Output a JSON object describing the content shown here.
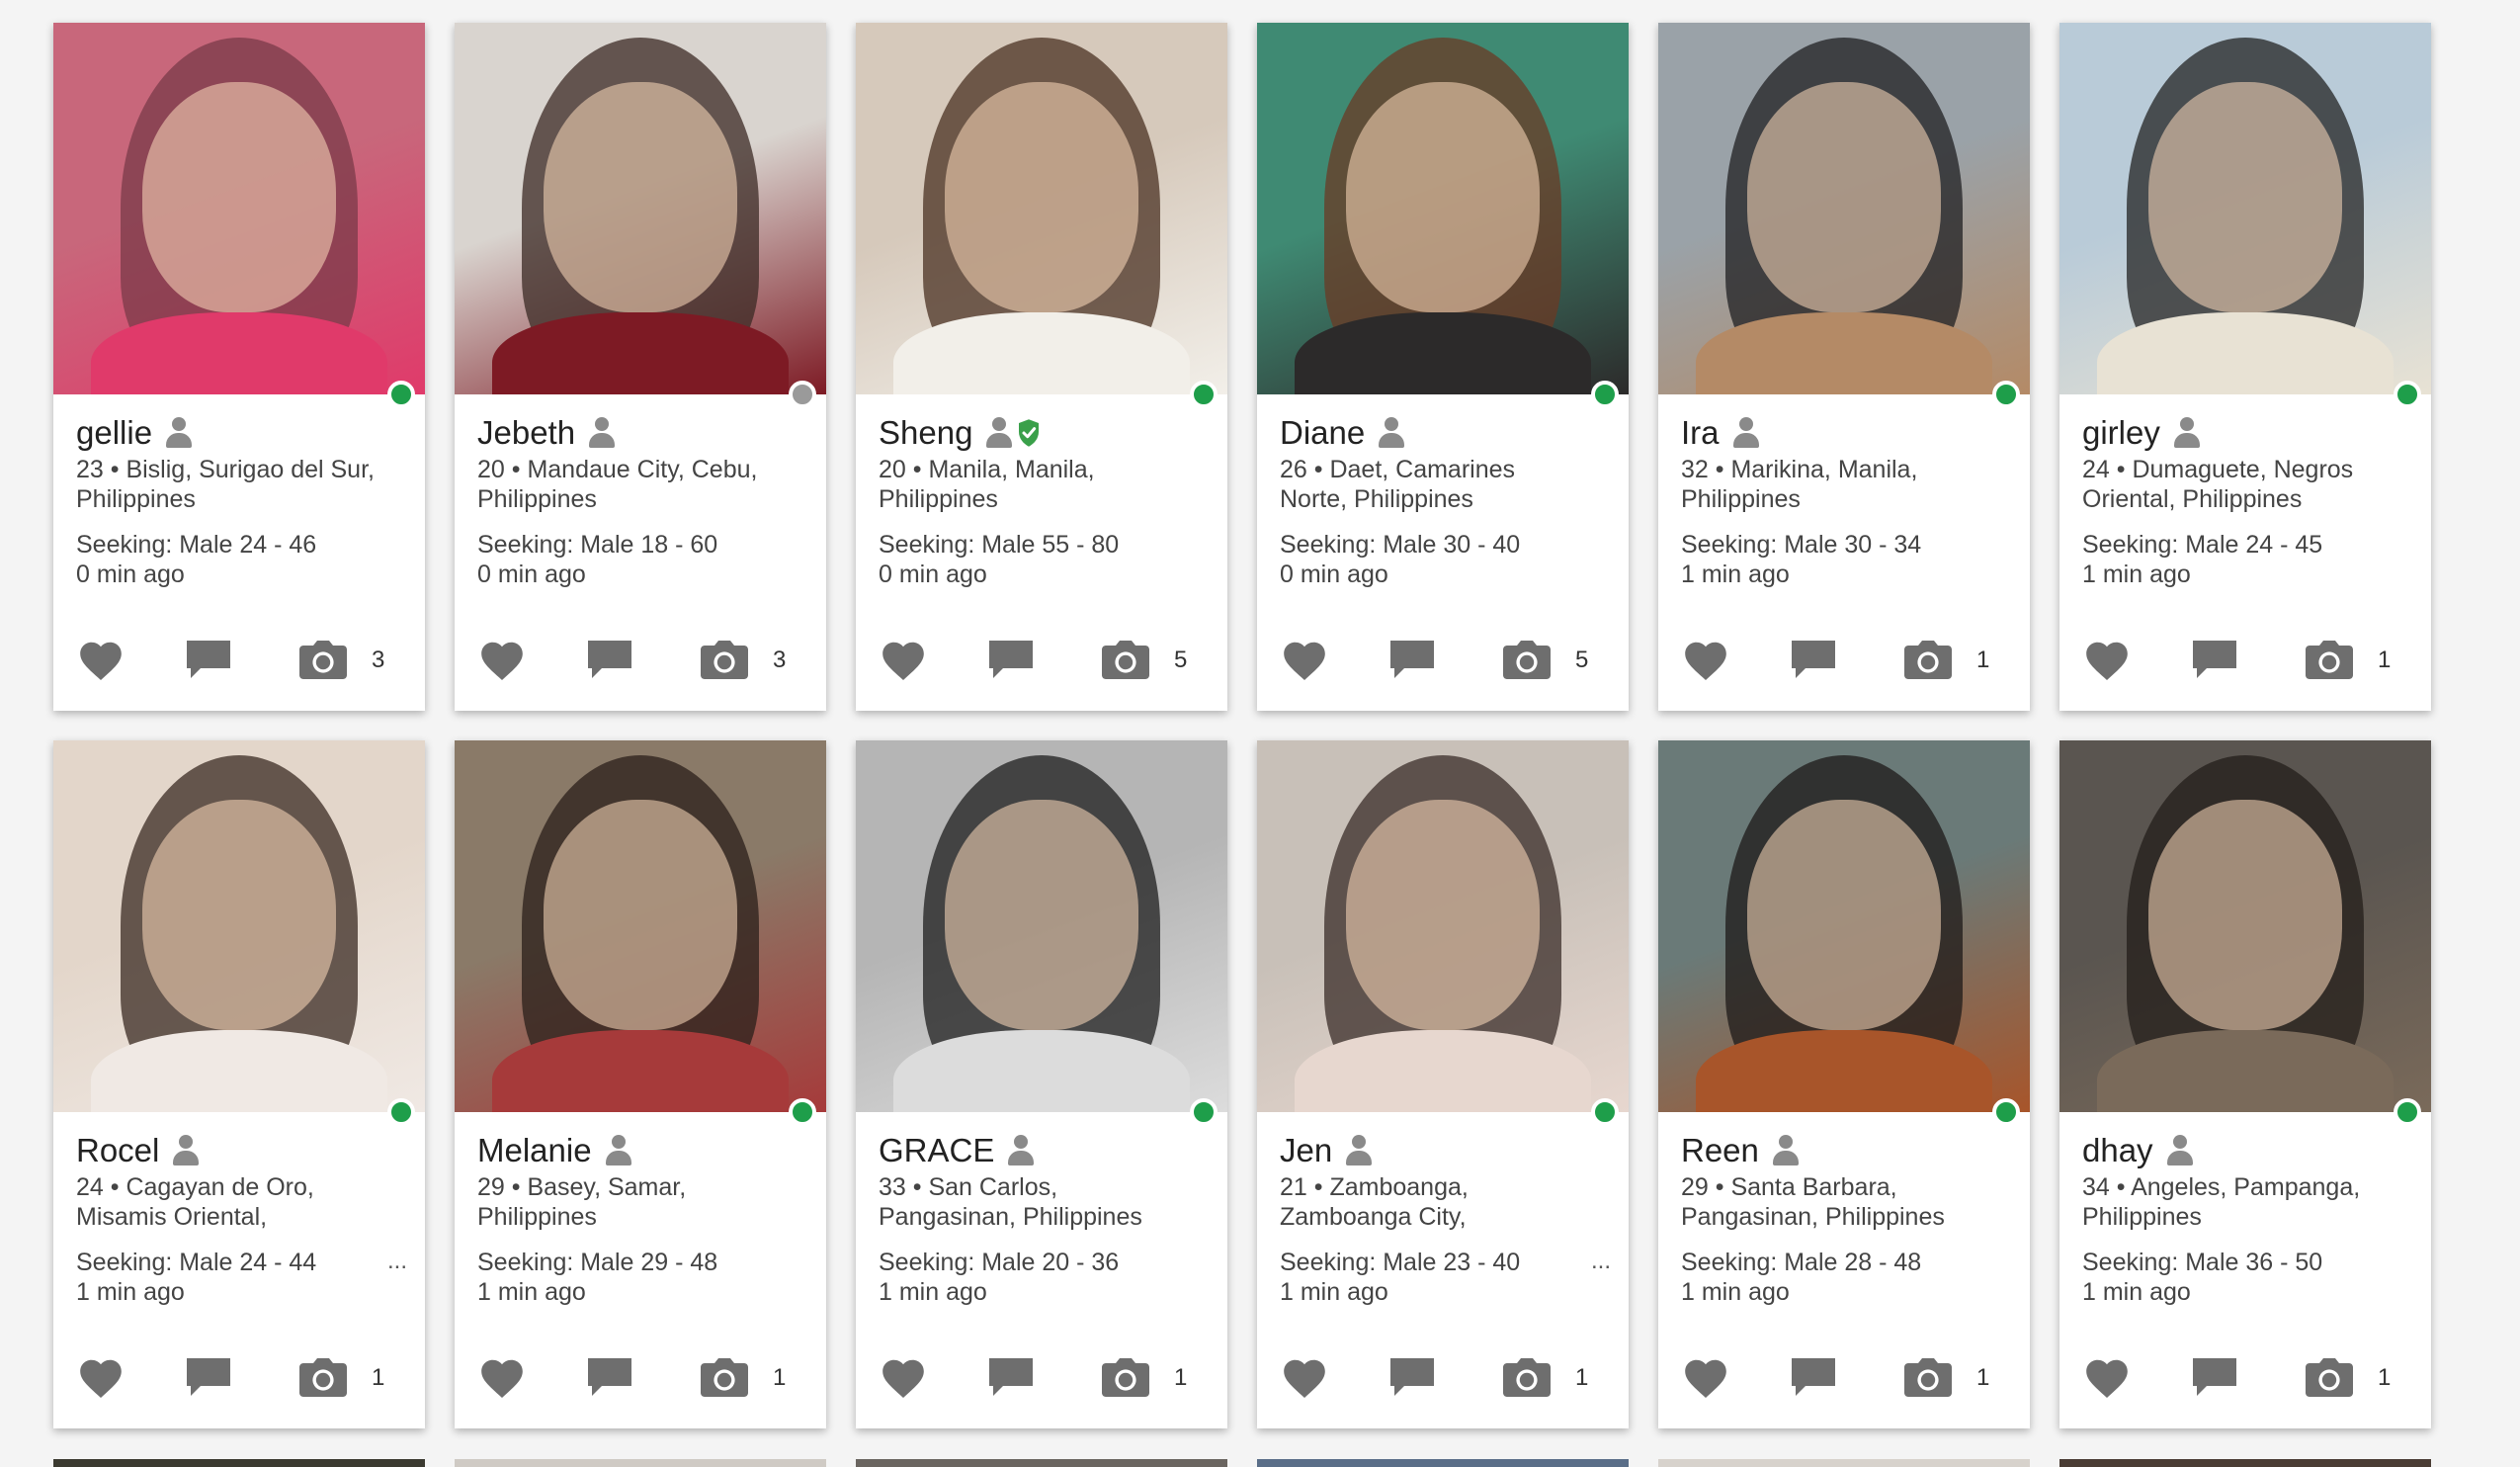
{
  "colors": {
    "online": "#1e9e4a",
    "offline": "#9a9a9a",
    "icon": "#6e6e6e",
    "verified": "#3aa04a"
  },
  "icons": {
    "like": "heart-icon",
    "message": "chat-bubble-icon",
    "photos": "camera-icon",
    "member": "person-icon",
    "verified": "verified-shield-icon"
  },
  "profiles": [
    {
      "name": "gellie",
      "age_location_1": "23 • Bislig, Surigao del Sur,",
      "age_location_2": "Philippines",
      "seeking": "Seeking: Male 24 - 46",
      "seen": "0 min ago",
      "photos": "3",
      "status": "online",
      "verified": false,
      "truncated": false,
      "palette": [
        "#c8677b",
        "#e03a6a",
        "#7a3a48"
      ]
    },
    {
      "name": "Jebeth",
      "age_location_1": "20 • Mandaue City, Cebu,",
      "age_location_2": "Philippines",
      "seeking": "Seeking: Male 18 - 60",
      "seen": "0 min ago",
      "photos": "3",
      "status": "offline",
      "verified": false,
      "truncated": false,
      "palette": [
        "#d9d4cf",
        "#7d1a24",
        "#3b2a24"
      ]
    },
    {
      "name": "Sheng",
      "age_location_1": "20 • Manila, Manila,",
      "age_location_2": "Philippines",
      "seeking": "Seeking: Male 55 - 80",
      "seen": "0 min ago",
      "photos": "5",
      "status": "online",
      "verified": true,
      "truncated": false,
      "palette": [
        "#d6c9bb",
        "#f2efe9",
        "#4a3022"
      ]
    },
    {
      "name": "Diane",
      "age_location_1": "26 • Daet, Camarines",
      "age_location_2": "Norte, Philippines",
      "seeking": "Seeking: Male 30 - 40",
      "seen": "0 min ago",
      "photos": "5",
      "status": "online",
      "verified": false,
      "truncated": false,
      "palette": [
        "#3f8a73",
        "#2c2a2a",
        "#6b3a24"
      ]
    },
    {
      "name": "Ira",
      "age_location_1": "32 • Marikina, Manila,",
      "age_location_2": "Philippines",
      "seeking": "Seeking: Male 30 - 34",
      "seen": "1 min ago",
      "photos": "1",
      "status": "online",
      "verified": false,
      "truncated": false,
      "palette": [
        "#9aa2a8",
        "#b48a66",
        "#1f1f22"
      ]
    },
    {
      "name": "girley",
      "age_location_1": "24 • Dumaguete, Negros",
      "age_location_2": "Oriental, Philippines",
      "seeking": "Seeking: Male 24 - 45",
      "seen": "1 min ago",
      "photos": "1",
      "status": "online",
      "verified": false,
      "truncated": false,
      "palette": [
        "#b9cbd8",
        "#e8e2d4",
        "#232323"
      ]
    },
    {
      "name": "Rocel",
      "age_location_1": "24 • Cagayan de Oro,",
      "age_location_2": "Misamis Oriental,",
      "seeking": "Seeking: Male 24 - 44",
      "seen": "1 min ago",
      "photos": "1",
      "status": "online",
      "verified": false,
      "truncated": true,
      "palette": [
        "#e3d6ca",
        "#f0e9e4",
        "#3a2a22"
      ]
    },
    {
      "name": "Melanie",
      "age_location_1": "29 • Basey, Samar,",
      "age_location_2": "Philippines",
      "seeking": "Seeking: Male 29 - 48",
      "seen": "1 min ago",
      "photos": "1",
      "status": "online",
      "verified": false,
      "truncated": false,
      "palette": [
        "#8a7a68",
        "#a63a3a",
        "#2a1f1a"
      ]
    },
    {
      "name": "GRACE",
      "age_location_1": "33 • San Carlos,",
      "age_location_2": "Pangasinan, Philippines",
      "seeking": "Seeking: Male 20 - 36",
      "seen": "1 min ago",
      "photos": "1",
      "status": "online",
      "verified": false,
      "truncated": false,
      "palette": [
        "#b5b5b5",
        "#dcdcdc",
        "#1d1d1d"
      ]
    },
    {
      "name": "Jen",
      "age_location_1": "21 • Zamboanga,",
      "age_location_2": "Zamboanga City,",
      "seeking": "Seeking: Male 23 - 40",
      "seen": "1 min ago",
      "photos": "1",
      "status": "online",
      "verified": false,
      "truncated": true,
      "palette": [
        "#c8c0b8",
        "#e7d7cf",
        "#3a2c28"
      ]
    },
    {
      "name": "Reen",
      "age_location_1": "29 • Santa Barbara,",
      "age_location_2": "Pangasinan, Philippines",
      "seeking": "Seeking: Male 28 - 48",
      "seen": "1 min ago",
      "photos": "1",
      "status": "online",
      "verified": false,
      "truncated": false,
      "palette": [
        "#6a7a78",
        "#a8552a",
        "#1d1a18"
      ]
    },
    {
      "name": "dhay",
      "age_location_1": "34 • Angeles, Pampanga,",
      "age_location_2": "Philippines",
      "seeking": "Seeking: Male 36 - 50",
      "seen": "1 min ago",
      "photos": "1",
      "status": "online",
      "verified": false,
      "truncated": false,
      "palette": [
        "#5a5550",
        "#7a6a5a",
        "#231d1a"
      ]
    }
  ]
}
